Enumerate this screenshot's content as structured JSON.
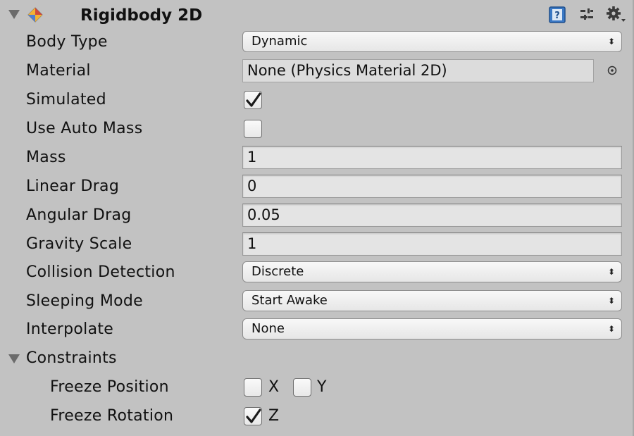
{
  "component": {
    "title": "Rigidbody 2D",
    "icon": "rigidbody2d-icon"
  },
  "header_icons": [
    "help-book-icon",
    "preset-sliders-icon",
    "settings-gear-icon"
  ],
  "fields": {
    "body_type": {
      "label": "Body Type",
      "value": "Dynamic"
    },
    "material": {
      "label": "Material",
      "value": "None (Physics Material 2D)"
    },
    "simulated": {
      "label": "Simulated",
      "checked": true
    },
    "use_auto_mass": {
      "label": "Use Auto Mass",
      "checked": false
    },
    "mass": {
      "label": "Mass",
      "value": "1"
    },
    "linear_drag": {
      "label": "Linear Drag",
      "value": "0"
    },
    "angular_drag": {
      "label": "Angular Drag",
      "value": "0.05"
    },
    "gravity_scale": {
      "label": "Gravity Scale",
      "value": "1"
    },
    "collision_detection": {
      "label": "Collision Detection",
      "value": "Discrete"
    },
    "sleeping_mode": {
      "label": "Sleeping Mode",
      "value": "Start Awake"
    },
    "interpolate": {
      "label": "Interpolate",
      "value": "None"
    }
  },
  "constraints": {
    "label": "Constraints",
    "freeze_position": {
      "label": "Freeze Position",
      "x_label": "X",
      "x_checked": false,
      "y_label": "Y",
      "y_checked": false
    },
    "freeze_rotation": {
      "label": "Freeze Rotation",
      "z_label": "Z",
      "z_checked": true
    }
  },
  "dropdown_glyph": "⬍",
  "colors": {
    "panel_bg": "#c2c2c2",
    "field_bg": "#e4e4e4",
    "help_icon_blue": "#3a78c4"
  }
}
